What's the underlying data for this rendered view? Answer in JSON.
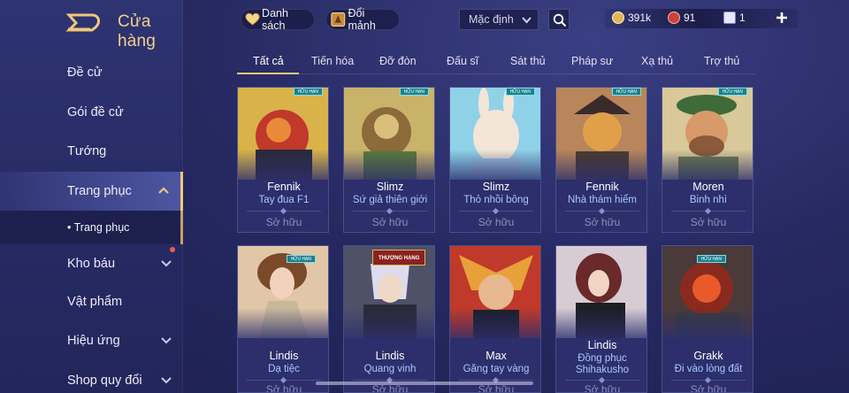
{
  "sidebar": {
    "title": "Cửa hàng",
    "items": [
      {
        "label": "Đề cử"
      },
      {
        "label": "Gói đề cử"
      },
      {
        "label": "Tướng"
      },
      {
        "label": "Trang phục"
      },
      {
        "label": "Kho báu"
      },
      {
        "label": "Vật phẩm"
      },
      {
        "label": "Hiệu ứng"
      },
      {
        "label": "Shop quy đổi"
      }
    ],
    "sub_item": "• Trang phục"
  },
  "topbar": {
    "list_label": "Danh sách",
    "exchange_label": "Đổi mảnh",
    "sort": {
      "selected": "Mặc định"
    },
    "currencies": {
      "gold": "391k",
      "gems": "91",
      "vouchers": "1"
    }
  },
  "tabs": [
    "Tất cả",
    "Tiến hóa",
    "Đỡ đòn",
    "Đấu sĩ",
    "Sát thủ",
    "Pháp sư",
    "Xạ thủ",
    "Trợ thủ"
  ],
  "cards": [
    {
      "hero": "Fennik",
      "skin": "Tay đua F1",
      "status": "Sở hữu",
      "badge": "HỮU HẠN"
    },
    {
      "hero": "Slimz",
      "skin": "Sứ giả thiên giới",
      "status": "Sở hữu",
      "badge": "HỮU HẠN"
    },
    {
      "hero": "Slimz",
      "skin": "Thỏ nhồi bông",
      "status": "Sở hữu",
      "badge": "HỮU HẠN"
    },
    {
      "hero": "Fennik",
      "skin": "Nhà thám hiểm",
      "status": "Sở hữu",
      "badge": "HỮU HẠN"
    },
    {
      "hero": "Moren",
      "skin": "Binh nhì",
      "status": "Sở hữu",
      "badge": "HỮU HẠN"
    },
    {
      "hero": "Lindis",
      "skin": "Dạ tiệc",
      "status": "Sở hữu",
      "badge": "HỮU HẠN"
    },
    {
      "hero": "Lindis",
      "skin": "Quang vinh",
      "status": "Sở hữu",
      "tag": "THƯỢNG HẠNG"
    },
    {
      "hero": "Max",
      "skin": "Găng tay vàng",
      "status": "Sở hữu"
    },
    {
      "hero": "Lindis",
      "skin": "Đồng phục Shihakusho",
      "skin_line1": "Đồng phục",
      "skin_line2": "Shihakusho",
      "status": "Sở hữu"
    },
    {
      "hero": "Grakk",
      "skin": "Đi vào lòng đất",
      "status": "Sở hữu",
      "badge": "HỮU HẠN"
    }
  ],
  "colors": {
    "accent_gold": "#f0c879",
    "skin_name_blue": "#a9c7ff",
    "owned_gray": "#8e90b6"
  }
}
